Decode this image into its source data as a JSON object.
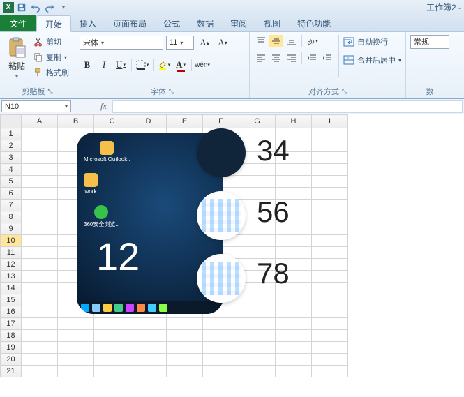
{
  "title_bar": {
    "workbook_name": "工作簿2 -"
  },
  "tabs": {
    "file": "文件",
    "items": [
      "开始",
      "插入",
      "页面布局",
      "公式",
      "数据",
      "审阅",
      "视图",
      "特色功能"
    ],
    "active": "开始"
  },
  "ribbon": {
    "clipboard": {
      "paste": "粘贴",
      "cut": "剪切",
      "copy": "复制",
      "format_painter": "格式刷",
      "label": "剪贴板"
    },
    "font": {
      "name": "宋体",
      "size": "11",
      "label": "字体"
    },
    "alignment": {
      "wrap": "自动换行",
      "merge": "合并后居中",
      "label": "对齐方式"
    },
    "number": {
      "format": "常规",
      "label": "数"
    }
  },
  "name_box": "N10",
  "columns": [
    "A",
    "B",
    "C",
    "D",
    "E",
    "F",
    "G",
    "H",
    "I"
  ],
  "rows": [
    "1",
    "2",
    "3",
    "4",
    "5",
    "6",
    "7",
    "8",
    "9",
    "10",
    "11",
    "12",
    "13",
    "14",
    "15",
    "16",
    "17",
    "18",
    "19",
    "20",
    "21"
  ],
  "selected_row": "10",
  "overlay": {
    "big": "12",
    "labels": [
      "34",
      "56",
      "78"
    ],
    "desk": {
      "outlook": "Microsoft Outlook..",
      "work": "work",
      "browser": "360安全浏览.."
    }
  }
}
